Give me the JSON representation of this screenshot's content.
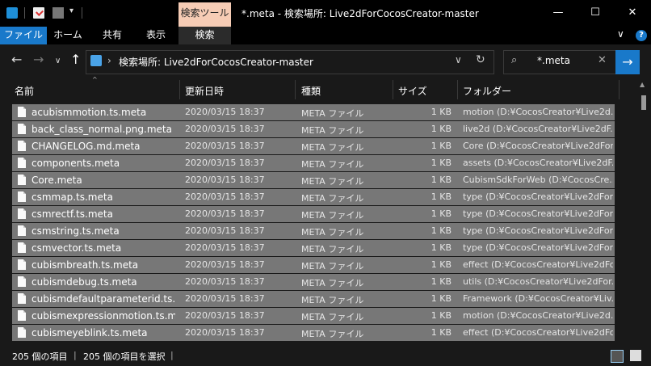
{
  "titlebar": {
    "context_tab": "検索ツール",
    "window_title": "*.meta - 検索場所: Live2dForCocosCreator-master",
    "dropdown_glyph": "▾",
    "minimize": "—",
    "maximize": "☐",
    "close": "✕"
  },
  "ribbon": {
    "tabs": [
      "ファイル",
      "ホーム",
      "共有",
      "表示",
      "検索"
    ],
    "collapse_glyph": "∨",
    "help_glyph": "?"
  },
  "nav": {
    "back": "←",
    "forward": "→",
    "recent": "∨",
    "up": "↑",
    "address_sep": "›",
    "address": "検索場所: Live2dForCocosCreator-master",
    "address_dropdown": "∨",
    "refresh": "↻",
    "search_icon": "⌕",
    "search_value": "*.meta",
    "search_clear": "✕",
    "search_go": "→"
  },
  "columns": {
    "name": "名前",
    "date": "更新日時",
    "type": "種類",
    "size": "サイズ",
    "folder": "フォルダー",
    "sort_indicator": "^"
  },
  "files": [
    {
      "name": "acubismmotion.ts.meta",
      "date": "2020/03/15 18:37",
      "type": "META ファイル",
      "size": "1 KB",
      "folder": "motion (D:¥CocosCreator¥Live2d..."
    },
    {
      "name": "back_class_normal.png.meta",
      "date": "2020/03/15 18:37",
      "type": "META ファイル",
      "size": "1 KB",
      "folder": "live2d (D:¥CocosCreator¥Live2dF..."
    },
    {
      "name": "CHANGELOG.md.meta",
      "date": "2020/03/15 18:37",
      "type": "META ファイル",
      "size": "1 KB",
      "folder": "Core (D:¥CocosCreator¥Live2dFor..."
    },
    {
      "name": "components.meta",
      "date": "2020/03/15 18:37",
      "type": "META ファイル",
      "size": "1 KB",
      "folder": "assets (D:¥CocosCreator¥Live2dF..."
    },
    {
      "name": "Core.meta",
      "date": "2020/03/15 18:37",
      "type": "META ファイル",
      "size": "1 KB",
      "folder": "CubismSdkForWeb (D:¥CocosCre..."
    },
    {
      "name": "csmmap.ts.meta",
      "date": "2020/03/15 18:37",
      "type": "META ファイル",
      "size": "1 KB",
      "folder": "type (D:¥CocosCreator¥Live2dFor..."
    },
    {
      "name": "csmrectf.ts.meta",
      "date": "2020/03/15 18:37",
      "type": "META ファイル",
      "size": "1 KB",
      "folder": "type (D:¥CocosCreator¥Live2dFor..."
    },
    {
      "name": "csmstring.ts.meta",
      "date": "2020/03/15 18:37",
      "type": "META ファイル",
      "size": "1 KB",
      "folder": "type (D:¥CocosCreator¥Live2dFor..."
    },
    {
      "name": "csmvector.ts.meta",
      "date": "2020/03/15 18:37",
      "type": "META ファイル",
      "size": "1 KB",
      "folder": "type (D:¥CocosCreator¥Live2dFor..."
    },
    {
      "name": "cubismbreath.ts.meta",
      "date": "2020/03/15 18:37",
      "type": "META ファイル",
      "size": "1 KB",
      "folder": "effect (D:¥CocosCreator¥Live2dFo..."
    },
    {
      "name": "cubismdebug.ts.meta",
      "date": "2020/03/15 18:37",
      "type": "META ファイル",
      "size": "1 KB",
      "folder": "utils (D:¥CocosCreator¥Live2dFor..."
    },
    {
      "name": "cubismdefaultparameterid.ts.m...",
      "date": "2020/03/15 18:37",
      "type": "META ファイル",
      "size": "1 KB",
      "folder": "Framework (D:¥CocosCreator¥Liv..."
    },
    {
      "name": "cubismexpressionmotion.ts.meta",
      "date": "2020/03/15 18:37",
      "type": "META ファイル",
      "size": "1 KB",
      "folder": "motion (D:¥CocosCreator¥Live2d..."
    },
    {
      "name": "cubismeyeblink.ts.meta",
      "date": "2020/03/15 18:37",
      "type": "META ファイル",
      "size": "1 KB",
      "folder": "effect (D:¥CocosCreator¥Live2dFo..."
    }
  ],
  "status": {
    "count": "205 個の項目",
    "selected": "205 個の項目を選択",
    "sep": "|"
  }
}
